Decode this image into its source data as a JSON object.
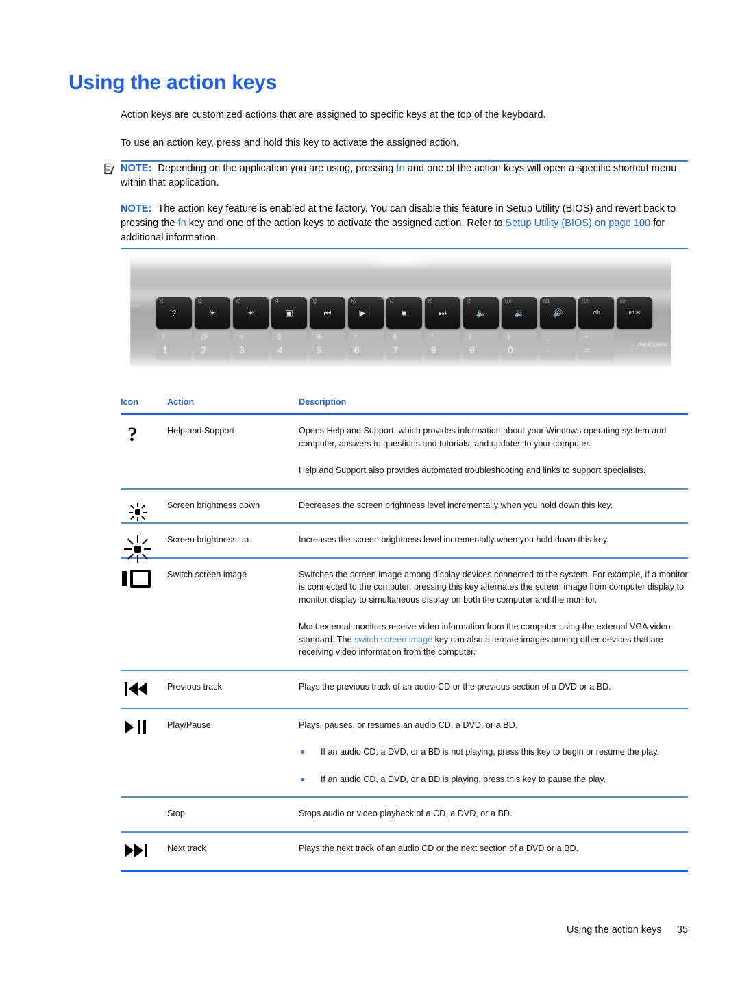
{
  "document": {
    "title": "Using the action keys",
    "intro_paragraphs": [
      "Action keys are customized actions that are assigned to specific keys at the top of the keyboard.",
      "To use an action key, press and hold this key to activate the assigned action."
    ]
  },
  "notes": [
    {
      "label": "NOTE:",
      "icon": "note-clipboard-icon",
      "text_part1": "Depending on the application you are using, pressing ",
      "inline_key": "fn",
      "text_part2": " and one of the action keys will open a specific shortcut menu within that application."
    },
    {
      "label": "NOTE:",
      "text_part1": "The action key feature is enabled at the factory. You can disable this feature in Setup Utility (BIOS) and revert back to pressing the ",
      "inline_key": "fn",
      "text_part2": " key and one of the action keys to activate the assigned action. Refer to ",
      "link_text": "Setup Utility (BIOS) on page 100",
      "text_part3": " for additional information."
    }
  ],
  "keyboard_image": {
    "alt": "Laptop keyboard top row showing action keys",
    "function_keys": [
      {
        "num": "f1",
        "glyph": "?"
      },
      {
        "num": "f2",
        "glyph": "☀"
      },
      {
        "num": "f3",
        "glyph": "☀"
      },
      {
        "num": "f4",
        "glyph": "▣"
      },
      {
        "num": "f5",
        "glyph": "⏮"
      },
      {
        "num": "f6",
        "glyph": "▶❘"
      },
      {
        "num": "f7",
        "glyph": "■"
      },
      {
        "num": "f8",
        "glyph": "⏭"
      },
      {
        "num": "f9",
        "glyph": "🔈"
      },
      {
        "num": "f10",
        "glyph": "🔉"
      },
      {
        "num": "f11",
        "glyph": "🔊"
      },
      {
        "num": "f12",
        "glyph": "wifi"
      },
      {
        "num": "ins",
        "glyph": "prt sc"
      }
    ],
    "number_keys": [
      {
        "sym": "!",
        "num": "1"
      },
      {
        "sym": "@",
        "num": "2"
      },
      {
        "sym": "#",
        "num": "3"
      },
      {
        "sym": "$",
        "num": "4"
      },
      {
        "sym": "%",
        "num": "5"
      },
      {
        "sym": "^",
        "num": "6"
      },
      {
        "sym": "&",
        "num": "7"
      },
      {
        "sym": "*",
        "num": "8"
      },
      {
        "sym": "(",
        "num": "9"
      },
      {
        "sym": ")",
        "num": "0"
      },
      {
        "sym": "_",
        "num": "-"
      },
      {
        "sym": "+",
        "num": "="
      }
    ],
    "esc_label": "esc",
    "backspace_label": "← backspace"
  },
  "table": {
    "headers": [
      "Icon",
      "Action",
      "Description"
    ],
    "rows": [
      {
        "icon": "question-mark-icon",
        "action": "Help and Support",
        "description_paragraphs": [
          "Opens Help and Support, which provides information about your Windows operating system and computer, answers to questions and tutorials, and updates to your computer.",
          "Help and Support also provides automated troubleshooting and links to support specialists."
        ]
      },
      {
        "icon": "brightness-down-icon",
        "action": "Screen brightness down",
        "description_paragraphs": [
          "Decreases the screen brightness level incrementally when you hold down this key."
        ]
      },
      {
        "icon": "brightness-up-icon",
        "action": "Screen brightness up",
        "description_paragraphs": [
          "Increases the screen brightness level incrementally when you hold down this key."
        ]
      },
      {
        "icon": "switch-screen-image-icon",
        "action": "Switch screen image",
        "description_paragraphs": [
          "Switches the screen image among display devices connected to the system. For example, if a monitor is connected to the computer, pressing this key alternates the screen image from computer display to monitor display to simultaneous display on both the computer and the monitor."
        ],
        "description_rich": {
          "part1": "Most external monitors receive video information from the computer using the external VGA video standard. The ",
          "link": "switch screen image",
          "part2": " key can also alternate images among other devices that are receiving video information from the computer."
        }
      },
      {
        "icon": "previous-track-icon",
        "action": "Previous track",
        "description_paragraphs": [
          "Plays the previous track of an audio CD or the previous section of a DVD or a BD."
        ]
      },
      {
        "icon": "play-pause-icon",
        "action": "Play/Pause",
        "description_paragraphs": [
          "Plays, pauses, or resumes an audio CD, a DVD, or a BD."
        ],
        "bullets": [
          "If an audio CD, a DVD, or a BD is not playing, press this key to begin or resume the play.",
          "If an audio CD, a DVD, or a BD is playing, press this key to pause the play."
        ]
      },
      {
        "icon": "stop-icon",
        "action": "Stop",
        "description_paragraphs": [
          "Stops audio or video playback of a CD, a DVD, or a BD."
        ]
      },
      {
        "icon": "next-track-icon",
        "action": "Next track",
        "description_paragraphs": [
          "Plays the next track of an audio CD or the next section of a DVD or a BD."
        ]
      }
    ]
  },
  "footer": {
    "section": "Using the action keys",
    "page_number": "35"
  },
  "colors": {
    "heading_blue": "#1f5fe8",
    "rule_blue": "#1f5fe8",
    "row_rule_blue": "#4a90e2",
    "link_blue": "#1f5fe8",
    "inline_blue": "#2f7de0",
    "soft_link_blue": "#4a8fe0"
  }
}
